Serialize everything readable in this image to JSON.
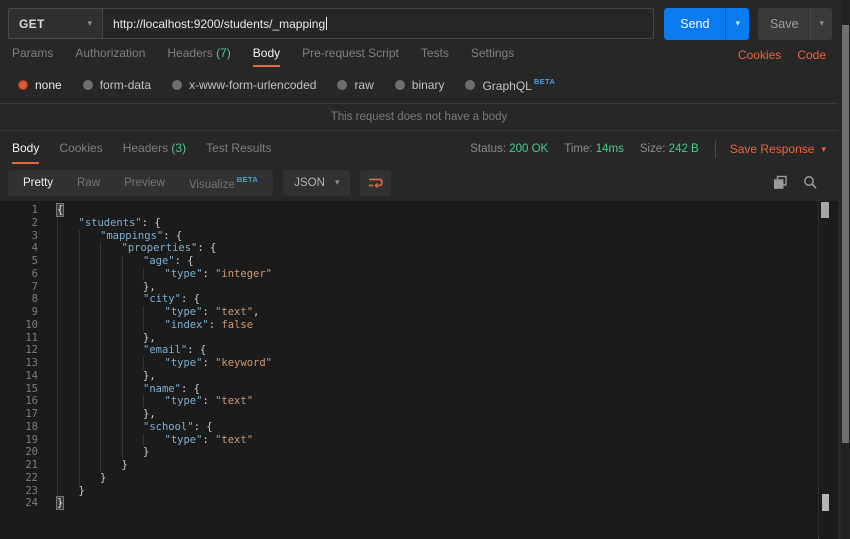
{
  "request": {
    "method": "GET",
    "url": "http://localhost:9200/students/_mapping",
    "send_label": "Send",
    "save_label": "Save",
    "tabs": [
      {
        "label": "Params"
      },
      {
        "label": "Authorization"
      },
      {
        "label": "Headers",
        "count": "(7)"
      },
      {
        "label": "Body",
        "active": true
      },
      {
        "label": "Pre-request Script"
      },
      {
        "label": "Tests"
      },
      {
        "label": "Settings"
      }
    ],
    "links": {
      "cookies": "Cookies",
      "code": "Code"
    },
    "body_types": [
      {
        "label": "none",
        "selected": true
      },
      {
        "label": "form-data"
      },
      {
        "label": "x-www-form-urlencoded"
      },
      {
        "label": "raw"
      },
      {
        "label": "binary"
      },
      {
        "label": "GraphQL",
        "badge": "BETA"
      }
    ],
    "empty_message": "This request does not have a body"
  },
  "response": {
    "tabs": [
      {
        "label": "Body",
        "active": true
      },
      {
        "label": "Cookies"
      },
      {
        "label": "Headers",
        "count": "(3)"
      },
      {
        "label": "Test Results"
      }
    ],
    "status_label": "Status:",
    "status_value": "200 OK",
    "time_label": "Time:",
    "time_value": "14ms",
    "size_label": "Size:",
    "size_value": "242 B",
    "save_response_label": "Save Response",
    "view_tabs": [
      {
        "label": "Pretty",
        "active": true
      },
      {
        "label": "Raw"
      },
      {
        "label": "Preview"
      },
      {
        "label": "Visualize",
        "badge": "BETA"
      }
    ],
    "format_select": "JSON"
  },
  "code": {
    "lines": [
      {
        "n": 1,
        "indent": 0,
        "tokens": [
          [
            "hl",
            "{"
          ]
        ]
      },
      {
        "n": 2,
        "indent": 1,
        "tokens": [
          [
            "k",
            "\"students\""
          ],
          [
            "p",
            ": {"
          ]
        ]
      },
      {
        "n": 3,
        "indent": 2,
        "tokens": [
          [
            "k",
            "\"mappings\""
          ],
          [
            "p",
            ": {"
          ]
        ]
      },
      {
        "n": 4,
        "indent": 3,
        "tokens": [
          [
            "k",
            "\"properties\""
          ],
          [
            "p",
            ": {"
          ]
        ]
      },
      {
        "n": 5,
        "indent": 4,
        "tokens": [
          [
            "k",
            "\"age\""
          ],
          [
            "p",
            ": {"
          ]
        ]
      },
      {
        "n": 6,
        "indent": 5,
        "tokens": [
          [
            "k",
            "\"type\""
          ],
          [
            "p",
            ": "
          ],
          [
            "s",
            "\"integer\""
          ]
        ]
      },
      {
        "n": 7,
        "indent": 4,
        "tokens": [
          [
            "p",
            "},"
          ]
        ]
      },
      {
        "n": 8,
        "indent": 4,
        "tokens": [
          [
            "k",
            "\"city\""
          ],
          [
            "p",
            ": {"
          ]
        ]
      },
      {
        "n": 9,
        "indent": 5,
        "tokens": [
          [
            "k",
            "\"type\""
          ],
          [
            "p",
            ": "
          ],
          [
            "s",
            "\"text\""
          ],
          [
            "p",
            ","
          ]
        ]
      },
      {
        "n": 10,
        "indent": 5,
        "tokens": [
          [
            "k",
            "\"index\""
          ],
          [
            "p",
            ": "
          ],
          [
            "b",
            "false"
          ]
        ]
      },
      {
        "n": 11,
        "indent": 4,
        "tokens": [
          [
            "p",
            "},"
          ]
        ]
      },
      {
        "n": 12,
        "indent": 4,
        "tokens": [
          [
            "k",
            "\"email\""
          ],
          [
            "p",
            ": {"
          ]
        ]
      },
      {
        "n": 13,
        "indent": 5,
        "tokens": [
          [
            "k",
            "\"type\""
          ],
          [
            "p",
            ": "
          ],
          [
            "s",
            "\"keyword\""
          ]
        ]
      },
      {
        "n": 14,
        "indent": 4,
        "tokens": [
          [
            "p",
            "},"
          ]
        ]
      },
      {
        "n": 15,
        "indent": 4,
        "tokens": [
          [
            "k",
            "\"name\""
          ],
          [
            "p",
            ": {"
          ]
        ]
      },
      {
        "n": 16,
        "indent": 5,
        "tokens": [
          [
            "k",
            "\"type\""
          ],
          [
            "p",
            ": "
          ],
          [
            "s",
            "\"text\""
          ]
        ]
      },
      {
        "n": 17,
        "indent": 4,
        "tokens": [
          [
            "p",
            "},"
          ]
        ]
      },
      {
        "n": 18,
        "indent": 4,
        "tokens": [
          [
            "k",
            "\"school\""
          ],
          [
            "p",
            ": {"
          ]
        ]
      },
      {
        "n": 19,
        "indent": 5,
        "tokens": [
          [
            "k",
            "\"type\""
          ],
          [
            "p",
            ": "
          ],
          [
            "s",
            "\"text\""
          ]
        ]
      },
      {
        "n": 20,
        "indent": 4,
        "tokens": [
          [
            "p",
            "}"
          ]
        ]
      },
      {
        "n": 21,
        "indent": 3,
        "tokens": [
          [
            "p",
            "}"
          ]
        ]
      },
      {
        "n": 22,
        "indent": 2,
        "tokens": [
          [
            "p",
            "}"
          ]
        ]
      },
      {
        "n": 23,
        "indent": 1,
        "tokens": [
          [
            "p",
            "}"
          ]
        ]
      },
      {
        "n": 24,
        "indent": 0,
        "tokens": [
          [
            "hl",
            "}"
          ]
        ]
      }
    ]
  },
  "colors": {
    "accent_orange": "#e8663c",
    "success_green": "#49cc90",
    "send_blue": "#097bed",
    "beta_blue": "#4e9ae8",
    "code_key_blue": "#7cb0d0",
    "code_string_salmon": "#cf9771",
    "code_background": "#1b1b1b",
    "app_background": "#272727"
  }
}
